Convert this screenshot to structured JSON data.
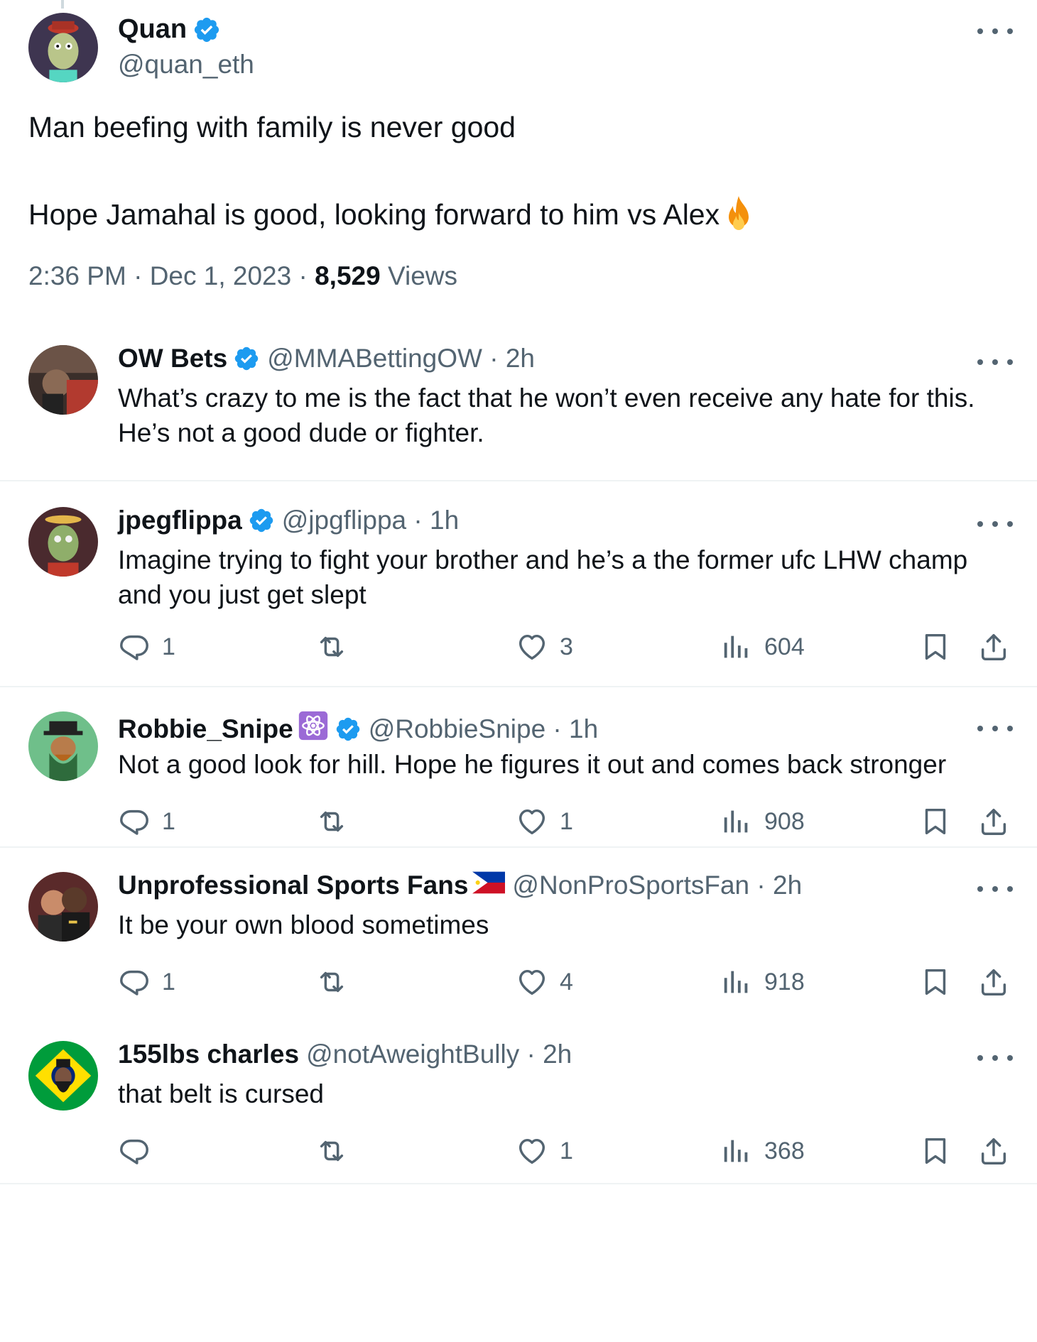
{
  "main_tweet": {
    "name": "Quan",
    "handle": "@quan_eth",
    "text_line1": "Man beefing with family is never good",
    "text_line2": "Hope Jamahal is good, looking forward to him vs Alex",
    "time": "2:36 PM",
    "date": "Dec 1, 2023",
    "views_count": "8,529",
    "views_label": "Views"
  },
  "replies": [
    {
      "name": "OW Bets",
      "handle": "@MMABettingOW · 2h",
      "text": "What’s crazy to me is the fact that he won’t even receive any hate for this. He’s not a good dude or fighter."
    },
    {
      "name": "jpegflippa",
      "handle": "@jpgflippa · 1h",
      "text": "Imagine trying to fight your brother and he’s a the former ufc LHW champ and you just get slept",
      "replies": "1",
      "retweets": "",
      "likes": "3",
      "views": "604"
    },
    {
      "name": "Robbie_Snipe",
      "handle": "@RobbieSnipe · 1h",
      "text": "Not a good look for hill. Hope he figures it out and comes back stronger",
      "replies": "1",
      "retweets": "",
      "likes": "1",
      "views": "908"
    },
    {
      "name": "Unprofessional Sports Fans",
      "handle": "@NonProSportsFan · 2h",
      "text": "It be your own blood sometimes",
      "replies": "1",
      "retweets": "",
      "likes": "4",
      "views": "918"
    },
    {
      "name": "155lbs charles",
      "handle": "@notAweightBully · 2h",
      "text": "that belt is cursed",
      "replies": "",
      "retweets": "",
      "likes": "1",
      "views": "368"
    }
  ],
  "icons": {
    "reply": "reply-icon",
    "retweet": "retweet-icon",
    "like": "heart-icon",
    "views": "views-icon",
    "bookmark": "bookmark-icon",
    "share": "share-icon",
    "verified": "verified-badge-icon",
    "more": "more-icon"
  },
  "colors": {
    "verified_blue": "#1d9bf0",
    "secondary_text": "#536471",
    "primary_text": "#0f1419",
    "separator": "#eff3f4"
  }
}
